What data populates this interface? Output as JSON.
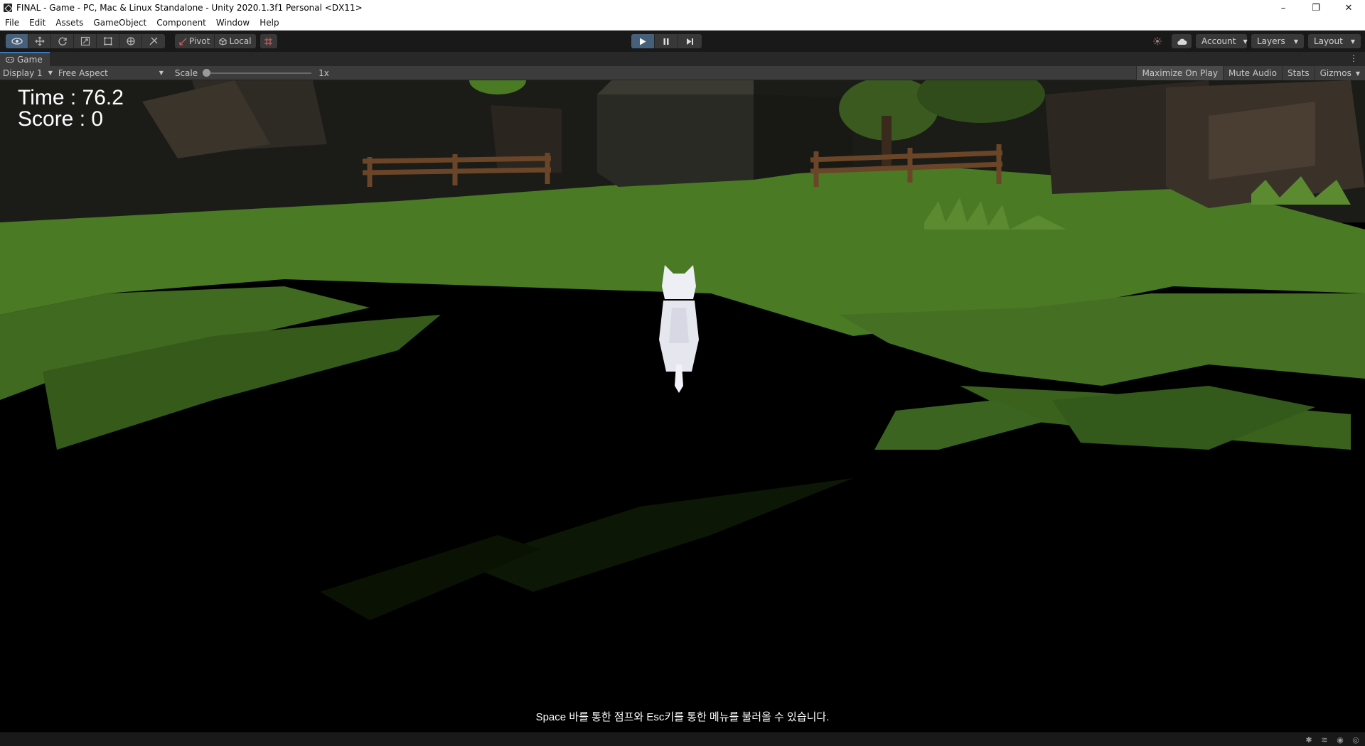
{
  "window": {
    "title": "FINAL - Game - PC, Mac & Linux Standalone - Unity 2020.1.3f1 Personal <DX11>",
    "controls": [
      "–",
      "❐",
      "✕"
    ]
  },
  "menu": [
    "File",
    "Edit",
    "Assets",
    "GameObject",
    "Component",
    "Window",
    "Help"
  ],
  "toolbar": {
    "tools": [
      "view-tool",
      "move-tool",
      "rotate-tool",
      "scale-tool",
      "rect-tool",
      "transform-tool",
      "custom-tool"
    ],
    "pivot_label": "Pivot",
    "local_label": "Local",
    "account_label": "Account",
    "layers_label": "Layers",
    "layout_label": "Layout"
  },
  "tab": {
    "label": "Game"
  },
  "gamebar": {
    "display": "Display 1",
    "aspect": "Free Aspect",
    "scale_label": "Scale",
    "scale_value": "1x",
    "maximize": "Maximize On Play",
    "mute": "Mute Audio",
    "stats": "Stats",
    "gizmos": "Gizmos"
  },
  "hud": {
    "time": "Time : 76.2",
    "score": "Score : 0"
  },
  "hint": "Space 바를 통한 점프와 Esc키를 통한 메뉴를 불러올 수 있습니다.",
  "colors": {
    "play_active": "#46607c",
    "grass": "#4a7a24",
    "shadow": "#000000"
  }
}
